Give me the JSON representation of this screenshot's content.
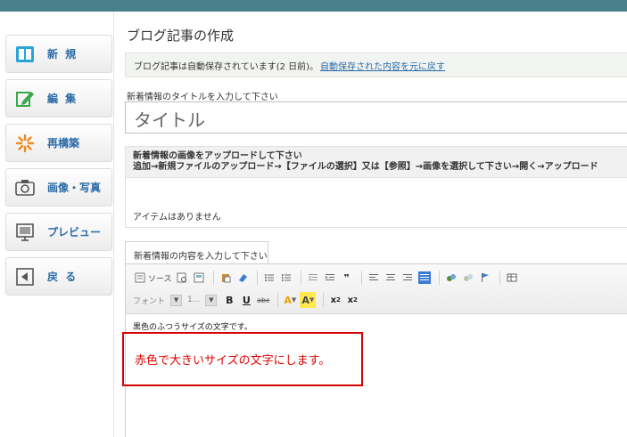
{
  "sidebar": {
    "items": [
      {
        "label": "新 規",
        "icon": "new-document-icon"
      },
      {
        "label": "編 集",
        "icon": "edit-icon"
      },
      {
        "label": "再構築",
        "icon": "rebuild-icon"
      },
      {
        "label": "画像・写真",
        "icon": "camera-icon"
      },
      {
        "label": "プレビュー",
        "icon": "preview-icon"
      },
      {
        "label": "戻 る",
        "icon": "back-icon"
      }
    ]
  },
  "main": {
    "page_title": "ブログ記事の作成",
    "autosave": {
      "text": "ブログ記事は自動保存されています(2 日前)。",
      "link": "自動保存された内容を元に戻す"
    },
    "title_label": "新着情報のタイトルを入力して下さい",
    "title_placeholder": "タイトル",
    "upload": {
      "heading": "新着情報の画像をアップロードして下さい",
      "instructions": "追加→新規ファイルのアップロード→【ファイルの選択】又は【参照】→画像を選択して下さい→開く→アップロード",
      "empty_text": "アイテムはありません"
    },
    "content_tab": "新着情報の内容を入力して下さい",
    "editor": {
      "source_label": "ソース",
      "font_label": "フォント",
      "size_label": "1...",
      "line1": "黒色のふつうサイズの文字です。",
      "line2": "赤色で大きいサイズの文字にします。"
    }
  },
  "colors": {
    "accent": "#2a6ba8",
    "red_text": "#e00000",
    "highlight_border": "#d60000"
  }
}
